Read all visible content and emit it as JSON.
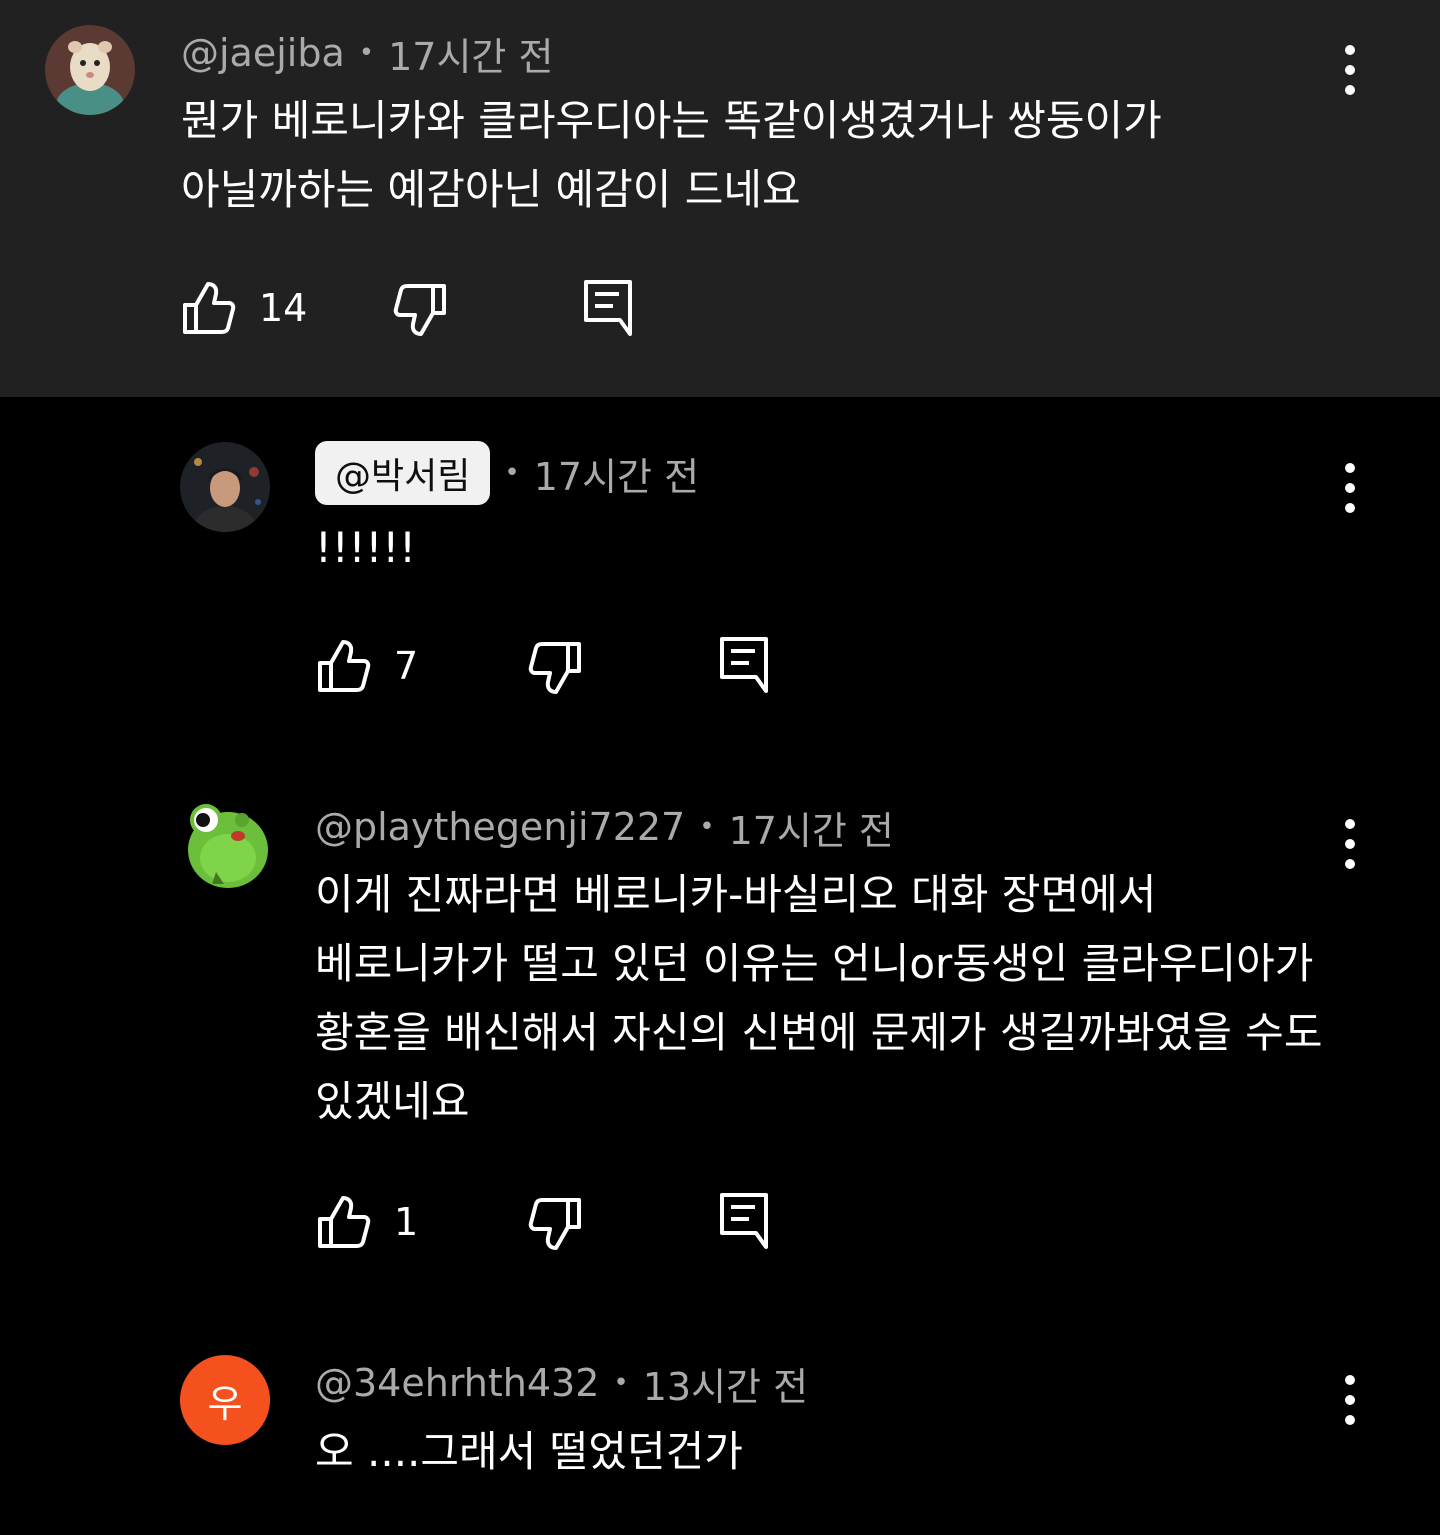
{
  "colors": {
    "highlight_background": "#212121",
    "page_background": "#000000",
    "meta_text": "#aaaaaa",
    "orange_avatar": "#f4511e"
  },
  "comments": [
    {
      "handle": "@jaejiba",
      "time": "17시간 전",
      "lines": [
        "뭔가 베로니카와 클라우디아는 똑같이생겼거나 쌍둥이가",
        "아닐까하는 예감아닌 예감이 드네요"
      ],
      "likes": "14",
      "avatar_icon": "ferret-avatar"
    },
    {
      "handle": "@박서림",
      "time": "17시간 전",
      "lines": [
        "!!!!!!"
      ],
      "likes": "7",
      "avatar_icon": "person-photo-avatar",
      "handle_highlighted": true
    },
    {
      "handle": "@playthegenji7227",
      "time": "17시간 전",
      "lines": [
        "이게 진짜라면 베로니카-바실리오 대화 장면에서",
        "베로니카가 떨고 있던 이유는 언니or동생인 클라우디아가",
        "황혼을 배신해서 자신의 신변에 문제가 생길까봐였을 수도",
        "있겠네요"
      ],
      "likes": "1",
      "avatar_icon": "frog-avatar"
    },
    {
      "handle": "@34ehrhth432",
      "time": "13시간 전",
      "lines": [
        "오 ....그래서 떨었던건가"
      ],
      "avatar_letter": "우",
      "avatar_icon": "letter-avatar"
    }
  ]
}
